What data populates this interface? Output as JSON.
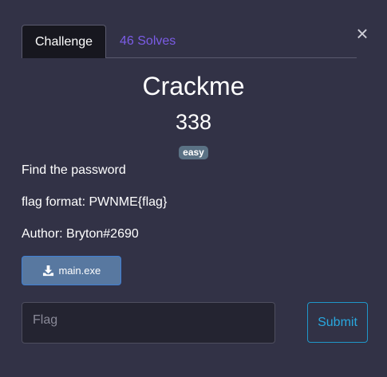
{
  "modal": {
    "close_symbol": "×",
    "tabs": [
      {
        "label": "Challenge",
        "active": true
      },
      {
        "label": "46 Solves",
        "active": false
      }
    ],
    "challenge": {
      "name": "Crackme",
      "points": "338",
      "difficulty": "easy",
      "description": [
        "Find the password",
        "flag format: PWNME{flag}",
        "Author: Bryton#2690"
      ],
      "file": {
        "name": "main.exe",
        "icon": "download-icon"
      }
    },
    "form": {
      "flag_value": "",
      "flag_placeholder": "Flag",
      "submit_label": "Submit"
    }
  },
  "colors": {
    "background": "#323246",
    "tab_active_bg": "#17171f",
    "tab_inactive_text": "#7b5ce6",
    "badge_bg": "#5b7285",
    "download_bg": "#5878a0",
    "download_border": "#3f7fd4",
    "submit_border": "#1f97c9",
    "submit_text": "#29a8df"
  }
}
